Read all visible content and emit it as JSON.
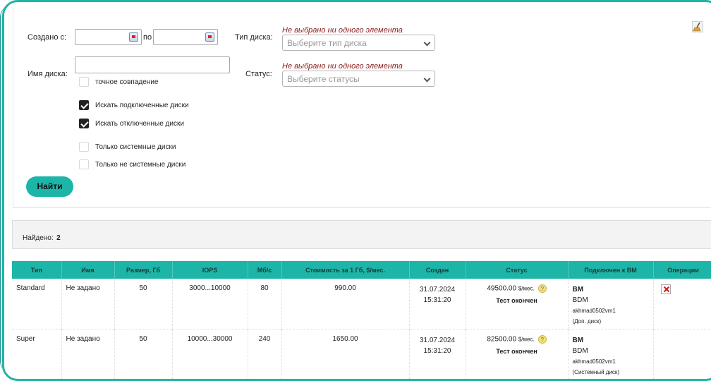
{
  "filters": {
    "created_from_label": "Создано с:",
    "to_label": "по",
    "created_from_value": "",
    "created_to_value": "",
    "disk_name_label": "Имя диска:",
    "disk_name_value": "",
    "exact_match_label": "точное совпадение",
    "exact_match_checked": false,
    "disk_type_label": "Тип диска:",
    "disk_type_hint": "Не выбрано ни одного элемента",
    "disk_type_placeholder": "Выберите тип диска",
    "status_label": "Статус:",
    "status_hint": "Не выбрано ни одного элемента",
    "status_placeholder": "Выберите статусы",
    "checkboxes": [
      {
        "label": "Искать подключенные диски",
        "checked": true
      },
      {
        "label": "Искать отключенные диски",
        "checked": true
      },
      {
        "label": "Только системные диски",
        "checked": false
      },
      {
        "label": "Только не системные диски",
        "checked": false
      }
    ],
    "find_button": "Найти"
  },
  "found": {
    "label": "Найдено:",
    "count": "2"
  },
  "table": {
    "headers": [
      "Тип",
      "Имя",
      "Размер, Гб",
      "IOPS",
      "Мб/с",
      "Стоимость за 1 Гб, $/мес.",
      "Создан",
      "Статус",
      "Подключен к ВМ",
      "Операции"
    ],
    "rows": [
      {
        "type": "Standard",
        "name": "Не задано",
        "size": "50",
        "iops": "3000...10000",
        "mbps": "80",
        "cost": "990.00",
        "created_date": "31.07.2024",
        "created_time": "15:31:20",
        "status_price": "49500.00",
        "status_unit": "$/мес.",
        "status_text": "Тест окончен",
        "vm_type": "ВМ",
        "vm_name": "BDM",
        "vm_id": "akhmad0502vm1",
        "vm_disk_role": "(Доп. диск)",
        "has_delete": true
      },
      {
        "type": "Super",
        "name": "Не задано",
        "size": "50",
        "iops": "10000...30000",
        "mbps": "240",
        "cost": "1650.00",
        "created_date": "31.07.2024",
        "created_time": "15:31:20",
        "status_price": "82500.00",
        "status_unit": "$/мес.",
        "status_text": "Тест окончен",
        "vm_type": "ВМ",
        "vm_name": "BDM",
        "vm_id": "akhmad0502vm1",
        "vm_disk_role": "(Системный диск)",
        "has_delete": false
      }
    ]
  },
  "colors": {
    "accent": "#1cb5a8",
    "error_text": "#d21414",
    "hint_text": "#8b1a1a"
  },
  "icons": {
    "calendar": "calendar-icon",
    "dropdown": "chevron-down-icon",
    "clear": "broom-icon",
    "help": "question-icon",
    "delete": "delete-icon"
  }
}
